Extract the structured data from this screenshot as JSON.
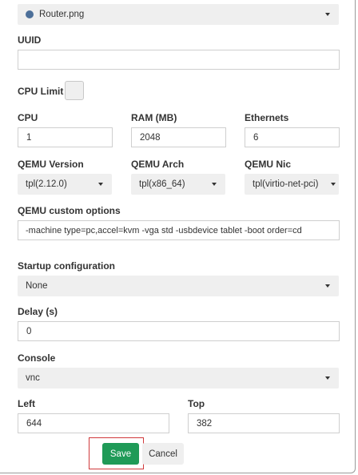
{
  "image": {
    "value": "Router.png",
    "icon": "router-image-icon"
  },
  "uuid": {
    "label": "UUID",
    "value": ""
  },
  "cpu_limit": {
    "label": "CPU Limit",
    "checked": false
  },
  "cpu": {
    "label": "CPU",
    "value": "1"
  },
  "ram": {
    "label": "RAM (MB)",
    "value": "2048"
  },
  "ethernets": {
    "label": "Ethernets",
    "value": "6"
  },
  "qemu_version": {
    "label": "QEMU Version",
    "value": "tpl(2.12.0)"
  },
  "qemu_arch": {
    "label": "QEMU Arch",
    "value": "tpl(x86_64)"
  },
  "qemu_nic": {
    "label": "QEMU Nic",
    "value": "tpl(virtio-net-pci)"
  },
  "qemu_options": {
    "label": "QEMU custom options",
    "value": "-machine type=pc,accel=kvm -vga std -usbdevice tablet -boot order=cd"
  },
  "startup_config": {
    "label": "Startup configuration",
    "value": "None"
  },
  "delay": {
    "label": "Delay (s)",
    "value": "0"
  },
  "console": {
    "label": "Console",
    "value": "vnc"
  },
  "left": {
    "label": "Left",
    "value": "644"
  },
  "top": {
    "label": "Top",
    "value": "382"
  },
  "actions": {
    "save": "Save",
    "cancel": "Cancel"
  },
  "colors": {
    "save": "#1f9a57",
    "highlight": "#d0393b"
  }
}
